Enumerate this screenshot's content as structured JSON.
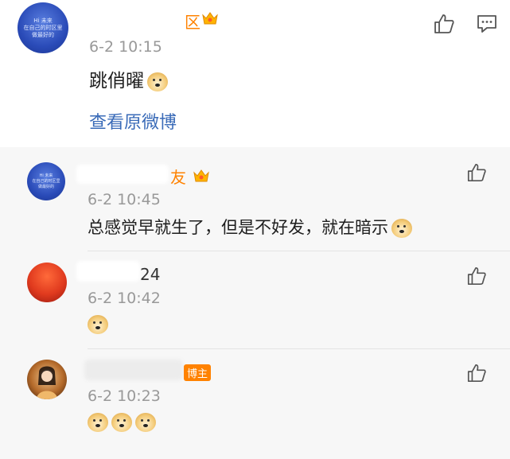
{
  "main_comment": {
    "avatar_caption": "Hi 未来\n在自己的时区里\n做最好的",
    "name_tail": "区",
    "time": "6-2 10:15",
    "text": "跳俏曜",
    "emoji": "doge",
    "view_original": "查看原微博",
    "icons": [
      "thumbs-up-icon",
      "comment-icon"
    ]
  },
  "replies": [
    {
      "avatar_caption": "Hi 未来\n在自己的时区里\n做最好的",
      "name_tail": "友",
      "time": "6-2 10:45",
      "text": "总感觉早就生了，但是不好发，就在暗示",
      "emoji": "doge"
    },
    {
      "name_tail": "24",
      "time": "6-2 10:42",
      "text": "",
      "emoji": "doge"
    },
    {
      "name_tail": "",
      "badge": "博主",
      "time": "6-2 10:23",
      "text": "",
      "emoji": "doge doge doge"
    }
  ]
}
